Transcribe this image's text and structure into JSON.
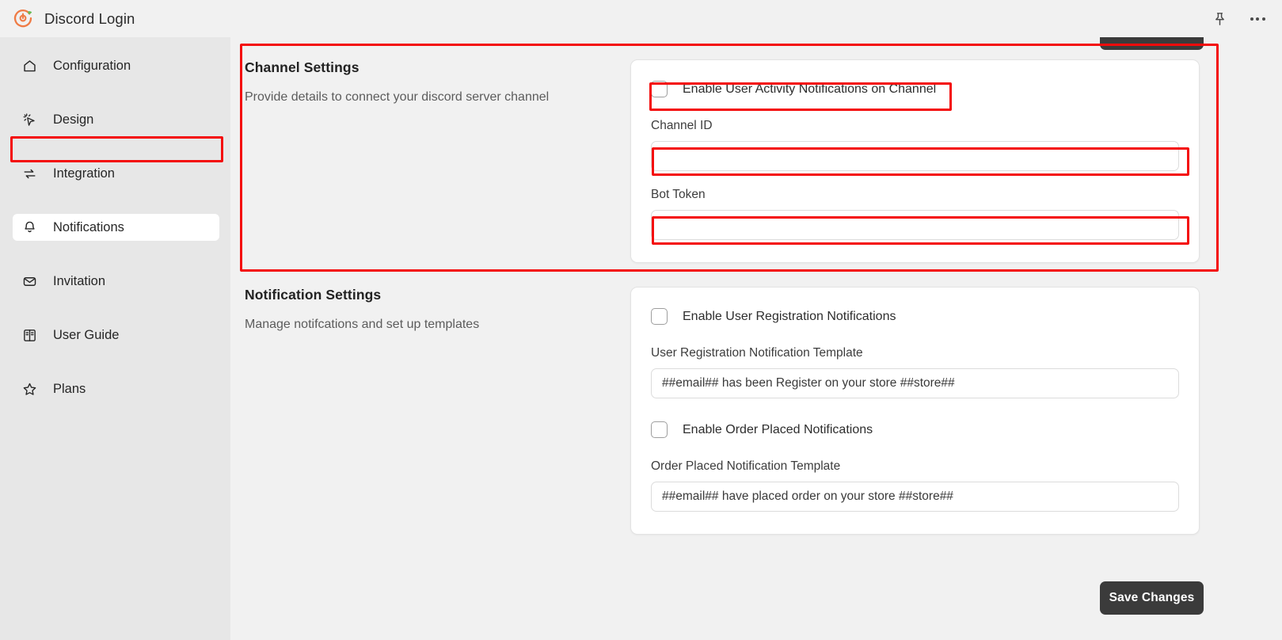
{
  "topbar": {
    "app_title": "Discord Login",
    "logo_icon": "discord-login-app-logo",
    "pin_icon": "pin-icon",
    "more_icon": "more-horizontal-icon"
  },
  "sidebar": {
    "items": [
      {
        "label": "Configuration",
        "icon": "home-icon",
        "active": false
      },
      {
        "label": "Design",
        "icon": "cursor-click-icon",
        "active": false
      },
      {
        "label": "Integration",
        "icon": "sync-arrows-icon",
        "active": false
      },
      {
        "label": "Notifications",
        "icon": "bell-icon",
        "active": true
      },
      {
        "label": "Invitation",
        "icon": "envelope-icon",
        "active": false
      },
      {
        "label": "User Guide",
        "icon": "book-icon",
        "active": false
      },
      {
        "label": "Plans",
        "icon": "star-icon",
        "active": false
      }
    ]
  },
  "channel_settings": {
    "title": "Channel Settings",
    "subtitle": "Provide details to connect your discord server channel",
    "enable_checkbox_label": "Enable User Activity Notifications on Channel",
    "enable_checked": false,
    "channel_id_label": "Channel ID",
    "channel_id_value": "",
    "channel_id_placeholder": "",
    "bot_token_label": "Bot Token",
    "bot_token_value": "",
    "bot_token_placeholder": ""
  },
  "notification_settings": {
    "title": "Notification Settings",
    "subtitle": "Manage notifcations and set up templates",
    "user_registration_checkbox_label": "Enable User Registration Notifications",
    "user_registration_checked": false,
    "user_registration_template_label": "User Registration Notification Template",
    "user_registration_template_value": "##email## has been Register on your store ##store##",
    "order_placed_checkbox_label": "Enable Order Placed Notifications",
    "order_placed_checked": false,
    "order_placed_template_label": "Order Placed Notification Template",
    "order_placed_template_value": "##email## have placed order on your store ##store##"
  },
  "footer": {
    "save_label": "Save Changes"
  },
  "annotations": {
    "highlight_color": "#f40b0b",
    "regions": [
      "notifications-sidebar-item",
      "channel-settings-section",
      "enable-user-activity-checkbox-row",
      "channel-id-input",
      "bot-token-input"
    ]
  }
}
